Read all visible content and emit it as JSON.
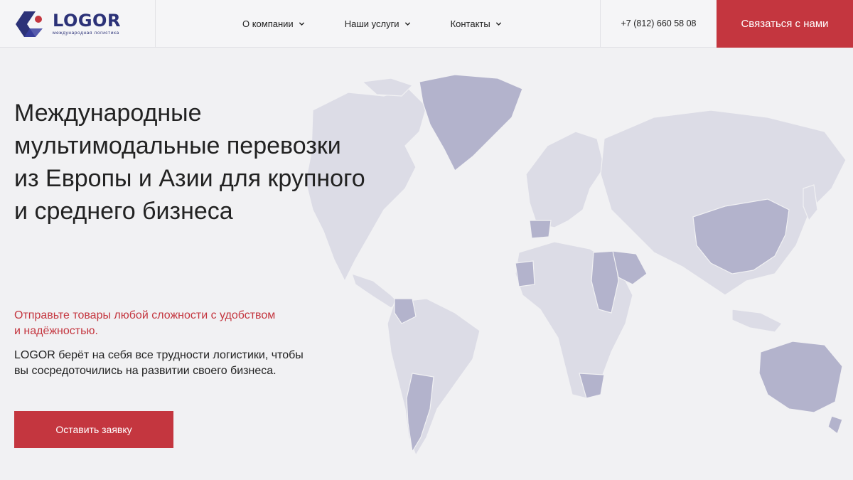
{
  "brand": {
    "name": "LOGOR",
    "tagline": "международная логистика",
    "primary_color": "#2c3278",
    "accent_color": "#c4363f"
  },
  "nav": {
    "items": [
      {
        "label": "О компании",
        "icon": "chevron-down-icon"
      },
      {
        "label": "Наши услуги",
        "icon": "chevron-down-icon"
      },
      {
        "label": "Контакты",
        "icon": "chevron-down-icon"
      }
    ]
  },
  "header": {
    "phone": "+7 (812) 660 58 08",
    "contact_label": "Связаться с нами"
  },
  "hero": {
    "title_lines": [
      "Международные",
      "мультимодальные перевозки",
      "из Европы и Азии для крупного",
      "и среднего бизнеса"
    ],
    "accent_lines": [
      "Отправьте товары любой сложности с удобством",
      "и надёжностью."
    ],
    "desc_lines": [
      "LOGOR берёт на себя все трудности логистики, чтобы",
      "вы сосредоточились на развитии своего бизнеса."
    ],
    "cta_label": "Оставить заявку"
  },
  "map": {
    "icon": "world-map",
    "land_color": "#dcdce6",
    "highlight_color": "#b3b3cc"
  }
}
